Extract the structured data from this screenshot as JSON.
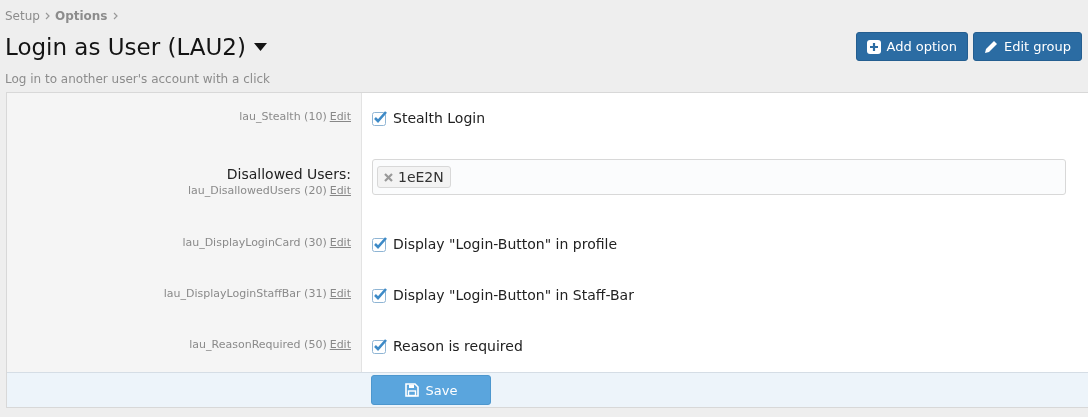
{
  "breadcrumb": [
    {
      "label": "Setup",
      "bold": false
    },
    {
      "label": "Options",
      "bold": true
    }
  ],
  "title": "Login as User (LAU2)",
  "description": "Log in to another user's account with a click",
  "actions": [
    {
      "label": "Add option",
      "kind": "add"
    },
    {
      "label": "Edit group",
      "kind": "edit"
    }
  ],
  "options": [
    {
      "kind": "checkbox",
      "option_id": "lau_Stealth (10)",
      "edit_link": "Edit",
      "label": "Stealth Login",
      "checked": true
    },
    {
      "kind": "tokens",
      "title": "Disallowed Users:",
      "option_id": "lau_DisallowedUsers (20)",
      "edit_link": "Edit",
      "tokens": [
        "1eE2N"
      ]
    },
    {
      "kind": "checkbox",
      "option_id": "lau_DisplayLoginCard (30)",
      "edit_link": "Edit",
      "label": "Display \"Login-Button\" in profile",
      "checked": true
    },
    {
      "kind": "checkbox",
      "option_id": "lau_DisplayLoginStaffBar (31)",
      "edit_link": "Edit",
      "label": "Display \"Login-Button\" in Staff-Bar",
      "checked": true
    },
    {
      "kind": "checkbox",
      "option_id": "lau_ReasonRequired (50)",
      "edit_link": "Edit",
      "label": "Reason is required",
      "checked": true
    }
  ],
  "save_button": "Save"
}
